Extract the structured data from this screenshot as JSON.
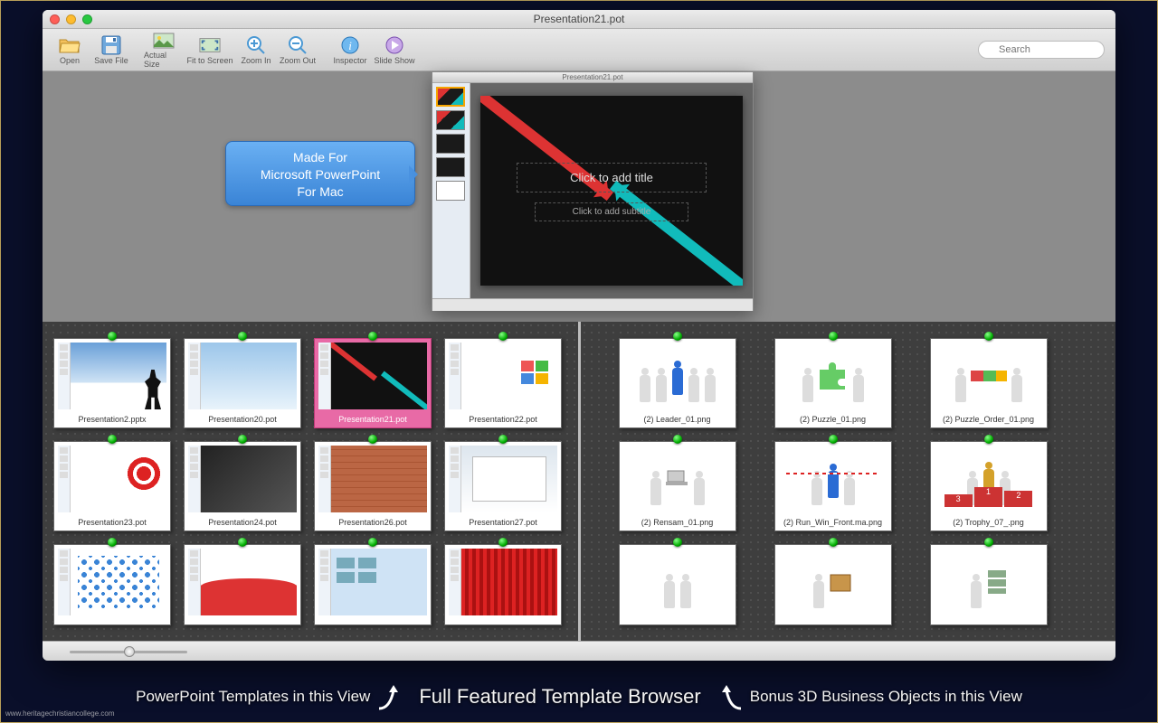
{
  "window": {
    "title": "Presentation21.pot"
  },
  "toolbar": {
    "open": "Open",
    "save": "Save File",
    "actual": "Actual Size",
    "fit": "Fit to Screen",
    "zoomin": "Zoom In",
    "zoomout": "Zoom Out",
    "inspector": "Inspector",
    "slideshow": "Slide Show",
    "search_placeholder": "Search"
  },
  "callout": {
    "l1": "Made For",
    "l2": "Microsoft PowerPoint",
    "l3": "For Mac"
  },
  "slide": {
    "title_ph": "Click to add title",
    "subtitle_ph": "Click to add subtitle"
  },
  "templates": [
    {
      "name": "Presentation2.pptx",
      "art": "art-stand"
    },
    {
      "name": "Presentation20.pot",
      "art": "art-cloud"
    },
    {
      "name": "Presentation21.pot",
      "art": "art-arrows",
      "selected": true
    },
    {
      "name": "Presentation22.pot",
      "art": "art-boxes"
    },
    {
      "name": "Presentation23.pot",
      "art": "art-target"
    },
    {
      "name": "Presentation24.pot",
      "art": "art-building"
    },
    {
      "name": "Presentation26.pot",
      "art": "art-brick"
    },
    {
      "name": "Presentation27.pot",
      "art": "art-sign"
    },
    {
      "name": "",
      "art": "art-dots"
    },
    {
      "name": "",
      "art": "art-wave"
    },
    {
      "name": "",
      "art": "art-lblue"
    },
    {
      "name": "",
      "art": "art-stripes"
    }
  ],
  "objects": [
    {
      "name": "(2) Leader_01.png",
      "kind": "leader"
    },
    {
      "name": "(2) Puzzle_01.png",
      "kind": "puzzle"
    },
    {
      "name": "(2) Puzzle_Order_01.png",
      "kind": "puzzle2"
    },
    {
      "name": "(2) Rensam_01.png",
      "kind": "laptop"
    },
    {
      "name": "(2) Run_Win_Front.ma.png",
      "kind": "finish"
    },
    {
      "name": "(2) Trophy_07_.png",
      "kind": "trophy"
    },
    {
      "name": "",
      "kind": "carry"
    },
    {
      "name": "",
      "kind": "box"
    },
    {
      "name": "",
      "kind": "money"
    }
  ],
  "footer": {
    "left": "PowerPoint Templates in this View",
    "center": "Full Featured Template Browser",
    "right": "Bonus 3D Business Objects in this View"
  },
  "watermark": "www.heritagechristiancollege.com"
}
